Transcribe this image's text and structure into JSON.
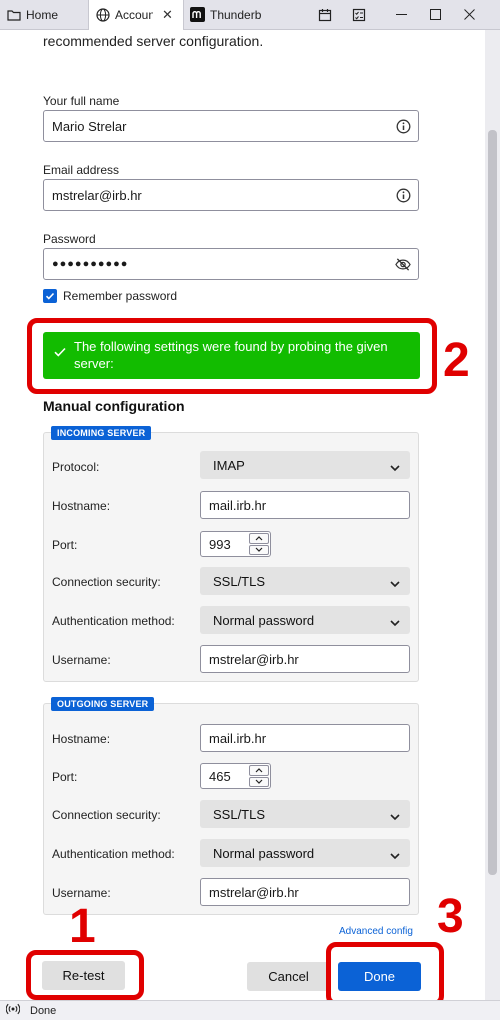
{
  "tabs": [
    {
      "label": "Home",
      "icon": "folder-icon"
    },
    {
      "label": "Account",
      "icon": "globe-icon"
    },
    {
      "label": "Thunderbird",
      "icon": "mozilla-icon"
    }
  ],
  "toolbar_icons": [
    "calendar-icon",
    "tasks-icon"
  ],
  "window_controls": [
    "minimize-icon",
    "maximize-icon",
    "close-icon"
  ],
  "form": {
    "intro_text": "recommended server configuration.",
    "fullname_label": "Your full name",
    "fullname_value": "Mario Strelar",
    "email_label": "Email address",
    "email_value": "mstrelar@irb.hr",
    "password_label": "Password",
    "password_value": "●●●●●●●●●●",
    "remember_label": "Remember password",
    "remember_checked": true
  },
  "success_message": "The following settings were found by probing the given server:",
  "manual_config": {
    "title": "Manual configuration",
    "incoming": {
      "badge": "INCOMING SERVER",
      "protocol_label": "Protocol:",
      "protocol_value": "IMAP",
      "hostname_label": "Hostname:",
      "hostname_value": "mail.irb.hr",
      "port_label": "Port:",
      "port_value": "993",
      "security_label": "Connection security:",
      "security_value": "SSL/TLS",
      "auth_label": "Authentication method:",
      "auth_value": "Normal password",
      "username_label": "Username:",
      "username_value": "mstrelar@irb.hr"
    },
    "outgoing": {
      "badge": "OUTGOING SERVER",
      "hostname_label": "Hostname:",
      "hostname_value": "mail.irb.hr",
      "port_label": "Port:",
      "port_value": "465",
      "security_label": "Connection security:",
      "security_value": "SSL/TLS",
      "auth_label": "Authentication method:",
      "auth_value": "Normal password",
      "username_label": "Username:",
      "username_value": "mstrelar@irb.hr"
    }
  },
  "advanced_config_label": "Advanced config",
  "buttons": {
    "retest": "Re-test",
    "cancel": "Cancel",
    "done": "Done"
  },
  "annotations": [
    "1",
    "2",
    "3"
  ],
  "status": {
    "text": "Done",
    "icon": "activity-icon"
  },
  "colors": {
    "accent": "#0b62d6",
    "success": "#12bc00",
    "annotation": "#e00000"
  }
}
